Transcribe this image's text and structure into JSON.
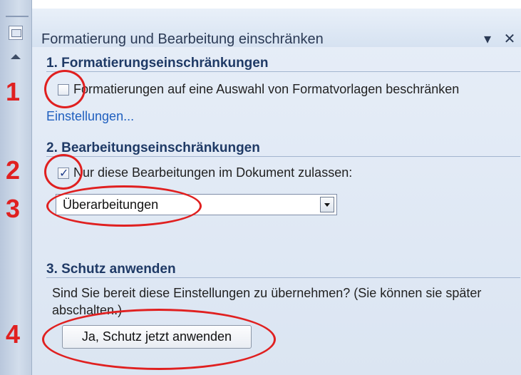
{
  "panel": {
    "title": "Formatierung und Bearbeitung einschränken",
    "controls": "▾ ✕"
  },
  "sections": {
    "formatting": {
      "heading": "1. Formatierungseinschränkungen",
      "checkbox_label": "Formatierungen auf eine Auswahl von Formatvorlagen beschränken",
      "checked": false,
      "settings_link": "Einstellungen..."
    },
    "editing": {
      "heading": "2. Bearbeitungseinschränkungen",
      "checkbox_label": "Nur diese Bearbeitungen im Dokument zulassen:",
      "checked": true,
      "selected_option": "Überarbeitungen"
    },
    "protection": {
      "heading": "3. Schutz anwenden",
      "description": "Sind Sie bereit diese Einstellungen zu übernehmen? (Sie können sie später abschalten.)",
      "button_label": "Ja, Schutz jetzt anwenden"
    }
  },
  "annotations": [
    "1",
    "2",
    "3",
    "4"
  ],
  "colors": {
    "annotation": "#e02020",
    "heading": "#1f3a66",
    "link": "#1f5fbf",
    "panel_bg": "#dbe5f2"
  },
  "icons": [
    "pane-icon",
    "scroll-up-icon",
    "dropdown-icon",
    "close-icon"
  ]
}
